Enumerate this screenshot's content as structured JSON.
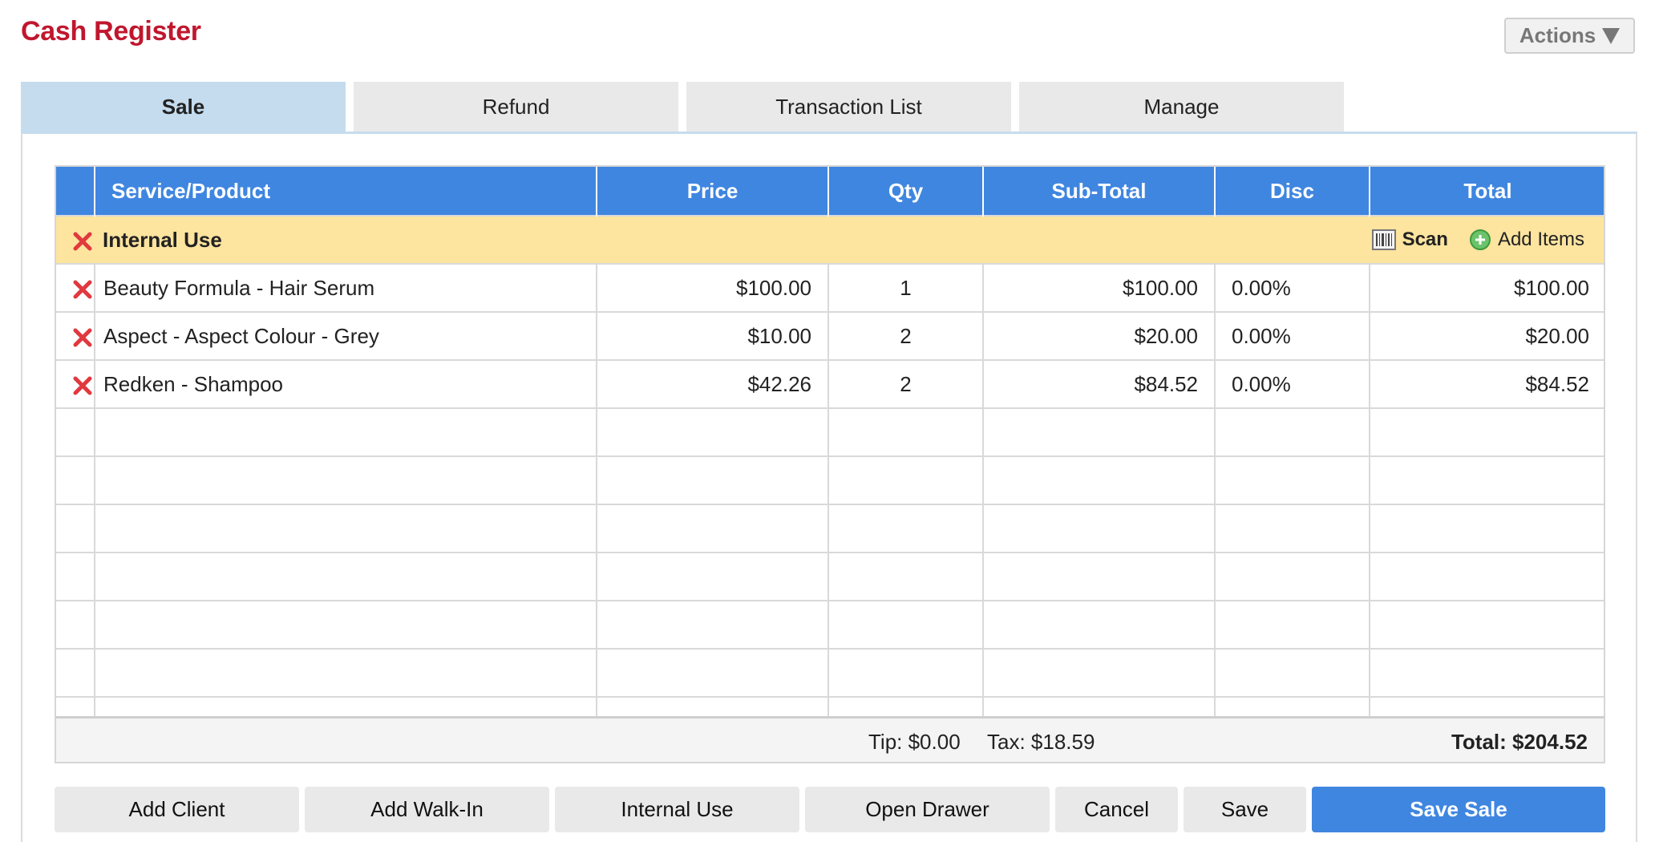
{
  "header": {
    "title": "Cash Register",
    "actions_label": "Actions"
  },
  "tabs": [
    {
      "label": "Sale",
      "active": true
    },
    {
      "label": "Refund",
      "active": false
    },
    {
      "label": "Transaction List",
      "active": false
    },
    {
      "label": "Manage",
      "active": false
    }
  ],
  "table": {
    "columns": [
      "Service/Product",
      "Price",
      "Qty",
      "Sub-Total",
      "Disc",
      "Total"
    ],
    "group": {
      "name": "Internal Use",
      "scan_label": "Scan",
      "add_items_label": "Add Items"
    },
    "rows": [
      {
        "name": "Beauty Formula - Hair Serum",
        "price": "$100.00",
        "qty": "1",
        "subtotal": "$100.00",
        "disc": "0.00%",
        "total": "$100.00"
      },
      {
        "name": "Aspect - Aspect Colour - Grey",
        "price": "$10.00",
        "qty": "2",
        "subtotal": "$20.00",
        "disc": "0.00%",
        "total": "$20.00"
      },
      {
        "name": "Redken - Shampoo",
        "price": "$42.26",
        "qty": "2",
        "subtotal": "$84.52",
        "disc": "0.00%",
        "total": "$84.52"
      }
    ],
    "empty_rows": 7
  },
  "summary": {
    "tip": "Tip: $0.00",
    "tax": "Tax: $18.59",
    "total": "Total: $204.52"
  },
  "buttons": {
    "add_client": "Add Client",
    "add_walk_in": "Add Walk-In",
    "internal_use": "Internal Use",
    "open_drawer": "Open Drawer",
    "cancel": "Cancel",
    "save": "Save",
    "save_sale": "Save Sale"
  },
  "colors": {
    "title": "#c0172e",
    "header_blue": "#3f86e0",
    "group_yellow": "#fde49f",
    "active_tab": "#c5dcee",
    "delete_red": "#e0393e",
    "add_green": "#5cb85c"
  },
  "icons": {
    "delete": "x-mark-icon",
    "scan": "barcode-icon",
    "add": "plus-circle-icon"
  }
}
